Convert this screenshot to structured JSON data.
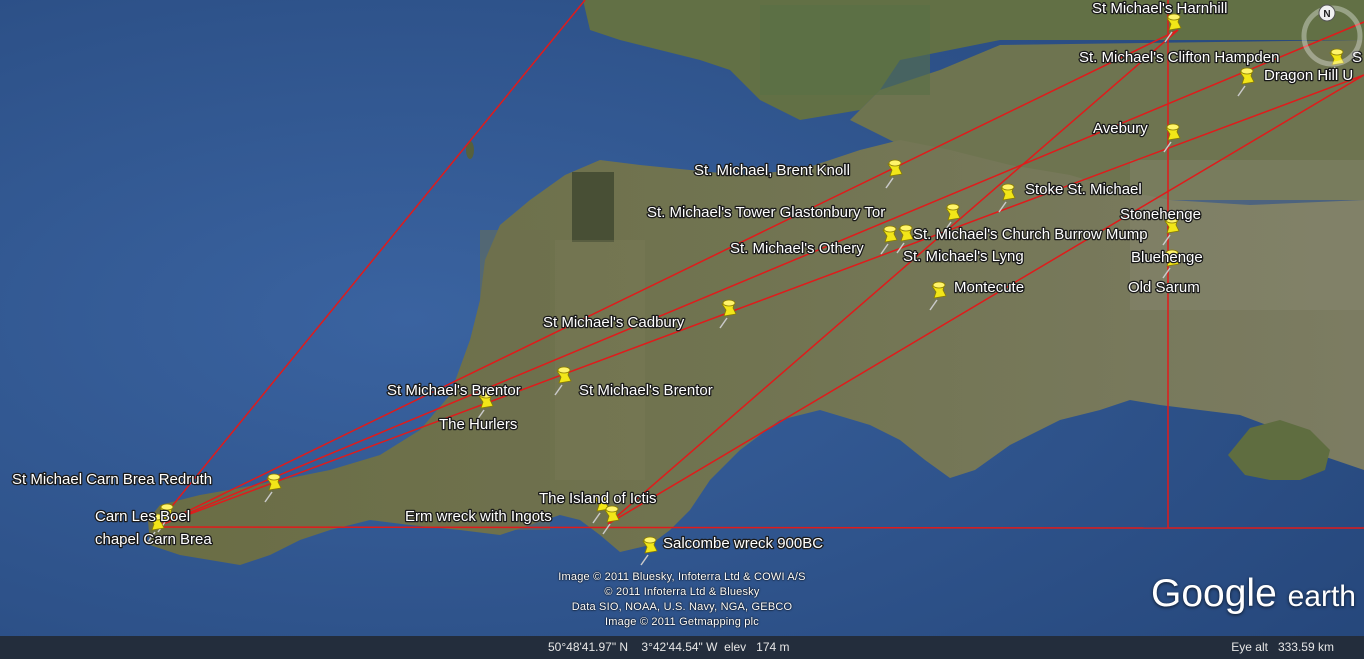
{
  "app": {
    "name": "Google Earth"
  },
  "logo": {
    "word1": "Google",
    "word2": "earth"
  },
  "compass": {
    "north_label": "N"
  },
  "credits": [
    "Image © 2011 Bluesky, Infoterra Ltd & COWI A/S",
    "© 2011 Infoterra Ltd & Bluesky",
    "Data SIO, NOAA, U.S. Navy, NGA, GEBCO",
    "Image © 2011 Getmapping plc"
  ],
  "status": {
    "coordinates": "50°48'41.97\" N    3°42'44.54\" W  elev   174 m",
    "eye_alt": "Eye alt   333.59 km"
  },
  "colors": {
    "sea": "#2d4f86",
    "land": "#6b7048",
    "route_lines": "#e01b1b",
    "pin": "#f2e618"
  },
  "placemarks": [
    {
      "id": "harnhill",
      "label": "St Michael's Harnhill"
    },
    {
      "id": "clifton-hampden",
      "label": "St. Michael's Clifton Hampden"
    },
    {
      "id": "edge-s",
      "label": "S"
    },
    {
      "id": "dragon-hill",
      "label": "Dragon Hill U"
    },
    {
      "id": "avebury",
      "label": "Avebury"
    },
    {
      "id": "brent-knoll",
      "label": "St. Michael, Brent Knoll"
    },
    {
      "id": "stoke",
      "label": "Stoke St. Michael"
    },
    {
      "id": "glastonbury",
      "label": "St. Michael's Tower Glastonbury Tor"
    },
    {
      "id": "stonehenge",
      "label": "Stonehenge"
    },
    {
      "id": "burrow-mump",
      "label": "St. Michael's Church Burrow Mump"
    },
    {
      "id": "othery",
      "label": "St. Michael's Othery"
    },
    {
      "id": "lyng",
      "label": "St. Michael's Lyng"
    },
    {
      "id": "bluehenge",
      "label": "Bluehenge"
    },
    {
      "id": "old-sarum",
      "label": "Old Sarum"
    },
    {
      "id": "montecute",
      "label": "Montecute"
    },
    {
      "id": "cadbury",
      "label": "St Michael's Cadbury"
    },
    {
      "id": "brentor-1",
      "label": "St Michael's Brentor"
    },
    {
      "id": "brentor-2",
      "label": "St Michael's Brentor"
    },
    {
      "id": "hurlers",
      "label": "The Hurlers"
    },
    {
      "id": "carn-brea-redruth",
      "label": "St Michael  Carn Brea Redruth"
    },
    {
      "id": "carn-les-boel",
      "label": "Carn Les Boel"
    },
    {
      "id": "chapel-carn-brea",
      "label": "chapel Carn Brea"
    },
    {
      "id": "ictis",
      "label": "The Island of Ictis"
    },
    {
      "id": "erm-wreck",
      "label": "Erm wreck with Ingots"
    },
    {
      "id": "salcombe",
      "label": "Salcombe wreck 900BC"
    }
  ]
}
